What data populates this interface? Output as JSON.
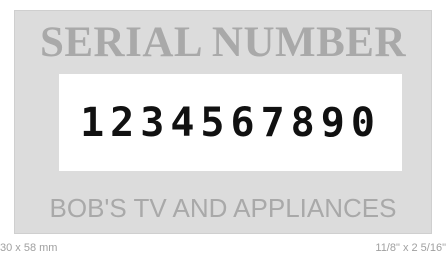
{
  "stamp": {
    "title": "SERIAL NUMBER",
    "number": "1234567890",
    "footer": "BOB'S TV AND APPLIANCES"
  },
  "dimensions": {
    "metric": "30 x 58 mm",
    "imperial": "11/8\" x 2 5/16\""
  },
  "colors": {
    "plate": "#dcdcdc",
    "window": "#ffffff",
    "engraved_text": "#a9a9a9",
    "digits": "#111111",
    "caption": "#a0a0a0"
  }
}
